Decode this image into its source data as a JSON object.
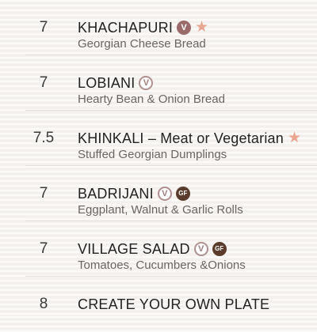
{
  "colors": {
    "background": "#f6f3f0",
    "vegetarian_badge": "#9e7d7c",
    "gluten_free_badge": "#5b3c2c",
    "favorite_star": "#e8a58f",
    "description_text": "#6a6562"
  },
  "menu": {
    "items": [
      {
        "price": "7",
        "name": "KHACHAPURI",
        "description": "Georgian Cheese Bread",
        "vegetarian_label": "V",
        "star_label": "★",
        "icons": [
          "vegetarian-badge-icon",
          "favorite-star-icon"
        ]
      },
      {
        "price": "7",
        "name": "LOBIANI",
        "description": "Hearty Bean & Onion Bread",
        "vegetarian_label": "V",
        "icons": [
          "vegetarian-badge-icon"
        ]
      },
      {
        "price": "7.5",
        "name": "KHINKALI – Meat or Vegetarian",
        "description": "Stuffed Georgian Dumplings",
        "star_label": "★",
        "icons": [
          "favorite-star-icon"
        ]
      },
      {
        "price": "7",
        "name": "BADRIJANI",
        "description": "Eggplant, Walnut & Garlic Rolls",
        "vegetarian_label": "V",
        "gluten_free_label": "GF",
        "icons": [
          "vegetarian-badge-icon",
          "gluten-free-badge-icon"
        ]
      },
      {
        "price": "7",
        "name": "VILLAGE SALAD",
        "description": "Tomatoes, Cucumbers &Onions",
        "vegetarian_label": "V",
        "gluten_free_label": "GF",
        "icons": [
          "vegetarian-badge-icon",
          "gluten-free-badge-icon"
        ]
      },
      {
        "price": "8",
        "name": "CREATE YOUR OWN PLATE",
        "description": "",
        "icons": []
      }
    ]
  }
}
